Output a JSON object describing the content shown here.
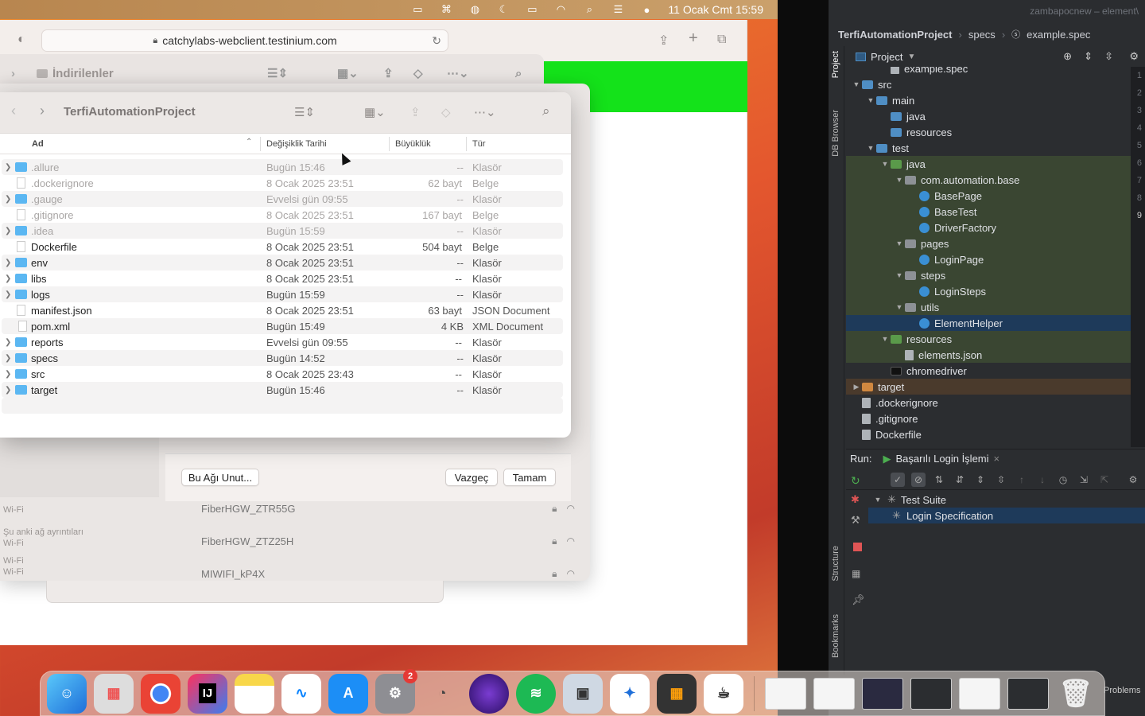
{
  "menubar": {
    "datetime": "11 Ocak Cmt  15:59"
  },
  "browser": {
    "url": "catchylabs-webclient.testinium.com"
  },
  "finder_back": {
    "title": "İndirilenler"
  },
  "finder": {
    "title": "TerfiAutomationProject",
    "columns": {
      "name": "Ad",
      "date": "Değişiklik Tarihi",
      "size": "Büyüklük",
      "kind": "Tür"
    },
    "rows": [
      {
        "name": ".allure",
        "date": "Bugün 15:46",
        "size": "--",
        "kind": "Klasör",
        "folder": true,
        "dim": true
      },
      {
        "name": ".dockerignore",
        "date": "8 Ocak 2025 23:51",
        "size": "62 bayt",
        "kind": "Belge",
        "folder": false,
        "dim": true
      },
      {
        "name": ".gauge",
        "date": "Evvelsi gün 09:55",
        "size": "--",
        "kind": "Klasör",
        "folder": true,
        "dim": true
      },
      {
        "name": ".gitignore",
        "date": "8 Ocak 2025 23:51",
        "size": "167 bayt",
        "kind": "Belge",
        "folder": false,
        "dim": true
      },
      {
        "name": ".idea",
        "date": "Bugün 15:59",
        "size": "--",
        "kind": "Klasör",
        "folder": true,
        "dim": true
      },
      {
        "name": "Dockerfile",
        "date": "8 Ocak 2025 23:51",
        "size": "504 bayt",
        "kind": "Belge",
        "folder": false,
        "dim": false
      },
      {
        "name": "env",
        "date": "8 Ocak 2025 23:51",
        "size": "--",
        "kind": "Klasör",
        "folder": true,
        "dim": false
      },
      {
        "name": "libs",
        "date": "8 Ocak 2025 23:51",
        "size": "--",
        "kind": "Klasör",
        "folder": true,
        "dim": false
      },
      {
        "name": "logs",
        "date": "Bugün 15:59",
        "size": "--",
        "kind": "Klasör",
        "folder": true,
        "dim": false
      },
      {
        "name": "manifest.json",
        "date": "8 Ocak 2025 23:51",
        "size": "63 bayt",
        "kind": "JSON Document",
        "folder": false,
        "dim": false
      },
      {
        "name": "pom.xml",
        "date": "Bugün 15:49",
        "size": "4 KB",
        "kind": "XML Document",
        "folder": false,
        "dim": false
      },
      {
        "name": "reports",
        "date": "Evvelsi gün 09:55",
        "size": "--",
        "kind": "Klasör",
        "folder": true,
        "dim": false
      },
      {
        "name": "specs",
        "date": "Bugün 14:52",
        "size": "--",
        "kind": "Klasör",
        "folder": true,
        "dim": false
      },
      {
        "name": "src",
        "date": "8 Ocak 2025 23:43",
        "size": "--",
        "kind": "Klasör",
        "folder": true,
        "dim": false
      },
      {
        "name": "target",
        "date": "Bugün 15:46",
        "size": "--",
        "kind": "Klasör",
        "folder": true,
        "dim": false
      }
    ]
  },
  "wifi": {
    "forget_label": "Bu Ağı Unut...",
    "cancel_label": "Vazgeç",
    "ok_label": "Tamam",
    "side_current": "Şu anki ağ ayrıntıları",
    "side_wifi": "Wi-Fi",
    "networks": [
      "FiberHGW_ZTR55G",
      "FiberHGW_ZTZ25H",
      "MIWIFI_kP4X"
    ]
  },
  "ide": {
    "window_title": "zambapocnew – element\\",
    "breadcrumb": [
      "TerfiAutomationProject",
      "specs",
      "example.spec"
    ],
    "project_label": "Project",
    "side_project": "Project",
    "side_db": "DB Browser",
    "side_structure": "Structure",
    "side_bookmarks": "Bookmarks",
    "tree": [
      {
        "label": "example.spec",
        "depth": 3,
        "icon": "file",
        "tw": "",
        "cls": ""
      },
      {
        "label": "src",
        "depth": 1,
        "icon": "blue",
        "tw": "▼",
        "cls": ""
      },
      {
        "label": "main",
        "depth": 2,
        "icon": "blue",
        "tw": "▼",
        "cls": ""
      },
      {
        "label": "java",
        "depth": 3,
        "icon": "blue",
        "tw": "",
        "cls": ""
      },
      {
        "label": "resources",
        "depth": 3,
        "icon": "blue",
        "tw": "",
        "cls": ""
      },
      {
        "label": "test",
        "depth": 2,
        "icon": "blue",
        "tw": "▼",
        "cls": ""
      },
      {
        "label": "java",
        "depth": 3,
        "icon": "green",
        "tw": "▼",
        "cls": "hl"
      },
      {
        "label": "com.automation.base",
        "depth": 4,
        "icon": "grey",
        "tw": "▼",
        "cls": "hl"
      },
      {
        "label": "BasePage",
        "depth": 5,
        "icon": "cls",
        "tw": "",
        "cls": "hl"
      },
      {
        "label": "BaseTest",
        "depth": 5,
        "icon": "cls",
        "tw": "",
        "cls": "hl"
      },
      {
        "label": "DriverFactory",
        "depth": 5,
        "icon": "cls",
        "tw": "",
        "cls": "hl"
      },
      {
        "label": "pages",
        "depth": 4,
        "icon": "grey",
        "tw": "▼",
        "cls": "hl"
      },
      {
        "label": "LoginPage",
        "depth": 5,
        "icon": "cls",
        "tw": "",
        "cls": "hl"
      },
      {
        "label": "steps",
        "depth": 4,
        "icon": "grey",
        "tw": "▼",
        "cls": "hl"
      },
      {
        "label": "LoginSteps",
        "depth": 5,
        "icon": "cls",
        "tw": "",
        "cls": "hl"
      },
      {
        "label": "utils",
        "depth": 4,
        "icon": "grey",
        "tw": "▼",
        "cls": "hl"
      },
      {
        "label": "ElementHelper",
        "depth": 5,
        "icon": "cls",
        "tw": "",
        "cls": "sel"
      },
      {
        "label": "resources",
        "depth": 3,
        "icon": "green",
        "tw": "▼",
        "cls": "hl"
      },
      {
        "label": "elements.json",
        "depth": 4,
        "icon": "file",
        "tw": "",
        "cls": "hl"
      },
      {
        "label": "chromedriver",
        "depth": 3,
        "icon": "black",
        "tw": "",
        "cls": ""
      },
      {
        "label": "target",
        "depth": 1,
        "icon": "orange",
        "tw": "▶",
        "cls": "tgt"
      },
      {
        "label": ".dockerignore",
        "depth": 1,
        "icon": "file",
        "tw": "",
        "cls": ""
      },
      {
        "label": ".gitignore",
        "depth": 1,
        "icon": "file",
        "tw": "",
        "cls": ""
      },
      {
        "label": "Dockerfile",
        "depth": 1,
        "icon": "file",
        "tw": "",
        "cls": ""
      }
    ],
    "gutter": [
      "1",
      "2",
      "3",
      "4",
      "5",
      "6",
      "7",
      "8",
      "9"
    ],
    "run_label": "Run:",
    "run_config": "Başarılı Login İşlemi",
    "run_tree": [
      {
        "label": "Test Suite",
        "depth": 0
      },
      {
        "label": "Login Specification",
        "depth": 1
      }
    ],
    "problems": "Problems"
  },
  "dock": {
    "settings_badge": "2"
  }
}
